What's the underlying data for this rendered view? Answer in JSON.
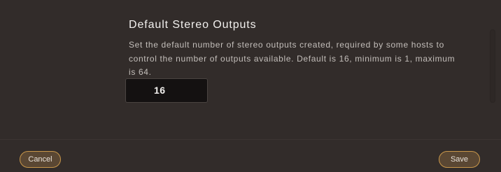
{
  "setting": {
    "title": "Default Stereo Outputs",
    "description": "Set the default number of stereo outputs created, required by some hosts to control the number of outputs available. Default is 16, minimum is 1, maximum is 64.",
    "value": "16"
  },
  "footer": {
    "cancel_label": "Cancel",
    "save_label": "Save"
  },
  "colors": {
    "background": "#322c2a",
    "accent_border": "#c9974a",
    "button_fill": "#5a4733",
    "input_background": "#141111"
  }
}
